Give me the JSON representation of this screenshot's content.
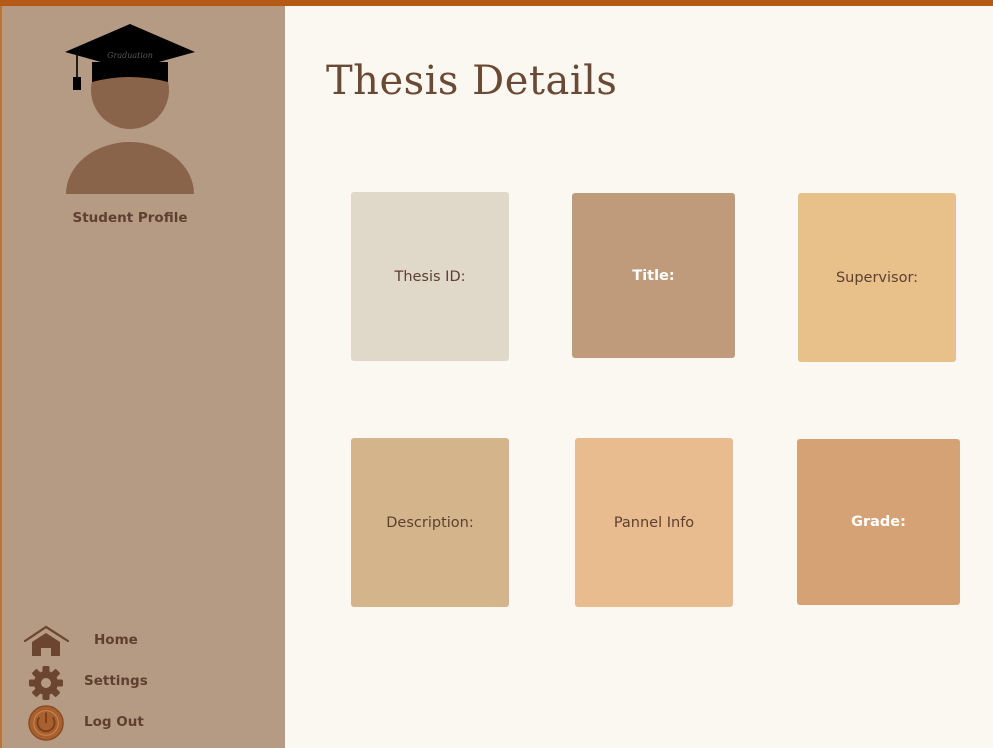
{
  "sidebar": {
    "profile_label": "Student Profile",
    "cap_text": "Graduation",
    "nav": [
      {
        "label": "Home",
        "icon": "home-icon"
      },
      {
        "label": "Settings",
        "icon": "gear-icon"
      },
      {
        "label": "Log Out",
        "icon": "power-icon"
      }
    ]
  },
  "main": {
    "title": "Thesis Details",
    "cards": [
      {
        "label": "Thesis ID:",
        "color": "#e0d8c8"
      },
      {
        "label": "Title:",
        "color": "#bf9b7b"
      },
      {
        "label": "Supervisor:",
        "color": "#e8c08a"
      },
      {
        "label": "Description:",
        "color": "#d3b48b"
      },
      {
        "label": "Pannel Info",
        "color": "#e9bc90"
      },
      {
        "label": "Grade:",
        "color": "#d5a276"
      }
    ]
  },
  "colors": {
    "accent": "#b55a14",
    "sidebar_bg": "#b59a84",
    "page_bg": "#faf8f0",
    "text_brown": "#5e4030"
  }
}
